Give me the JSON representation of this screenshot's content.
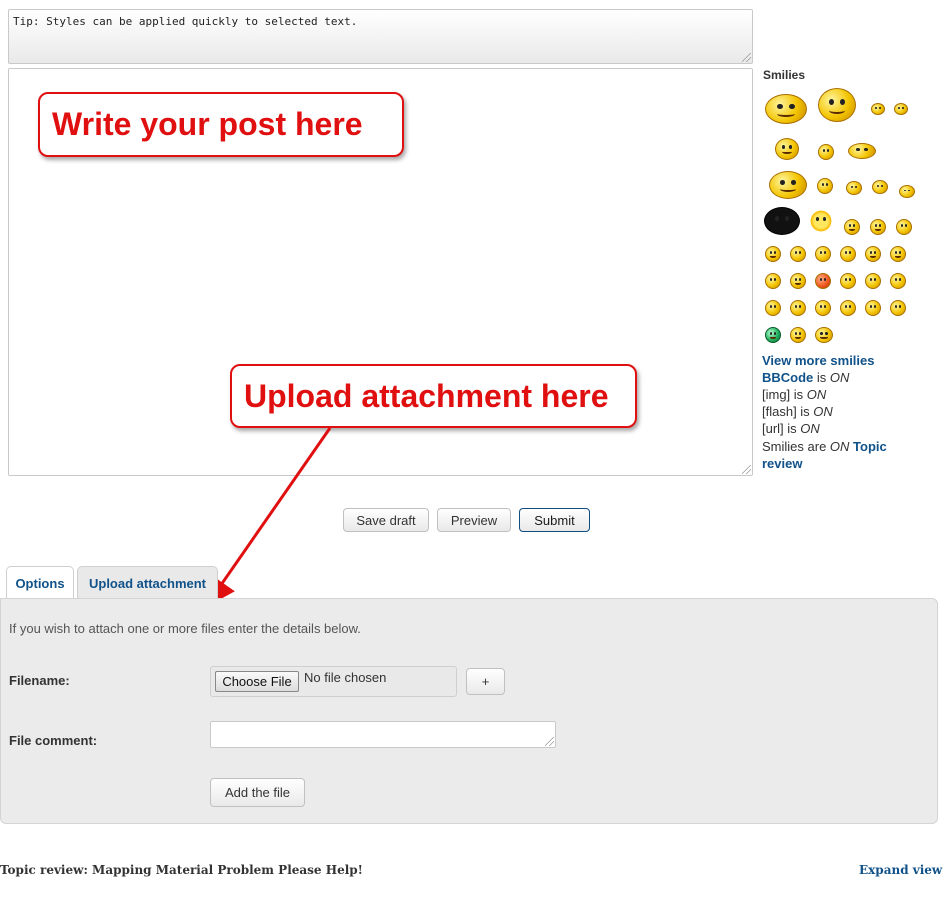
{
  "editor": {
    "tip": "Tip: Styles can be applied quickly to selected text.",
    "callout_write": "Write your post here",
    "callout_upload": "Upload attachment here"
  },
  "smilies": {
    "title": "Smilies",
    "view_more": "View more smilies",
    "bbcode_label": "BBCode",
    "bbcode_is": " is ",
    "bbcode_state": "ON",
    "img_label": "[img] is ",
    "img_state": "ON",
    "flash_label": "[flash] is ",
    "flash_state": "ON",
    "url_label": "[url] is ",
    "url_state": "ON",
    "smilies_label": "Smilies are ",
    "smilies_state": "ON",
    "topic_review_link": "Topic review"
  },
  "buttons": {
    "save_draft": "Save draft",
    "preview": "Preview",
    "submit": "Submit"
  },
  "tabs": {
    "options": "Options",
    "upload_attachment": "Upload attachment"
  },
  "attachment": {
    "intro": "If you wish to attach one or more files enter the details below.",
    "filename_label": "Filename:",
    "choose_file": "Choose File",
    "no_file": "No file chosen",
    "plus": "+",
    "comment_label": "File comment:",
    "add_file": "Add the file"
  },
  "footer": {
    "topic_review": "Topic review: Mapping Material Problem Please Help!",
    "expand_view": "Expand view"
  },
  "colors": {
    "callout": "#e01010",
    "link": "#105289",
    "panel_bg": "#ebebeb"
  }
}
